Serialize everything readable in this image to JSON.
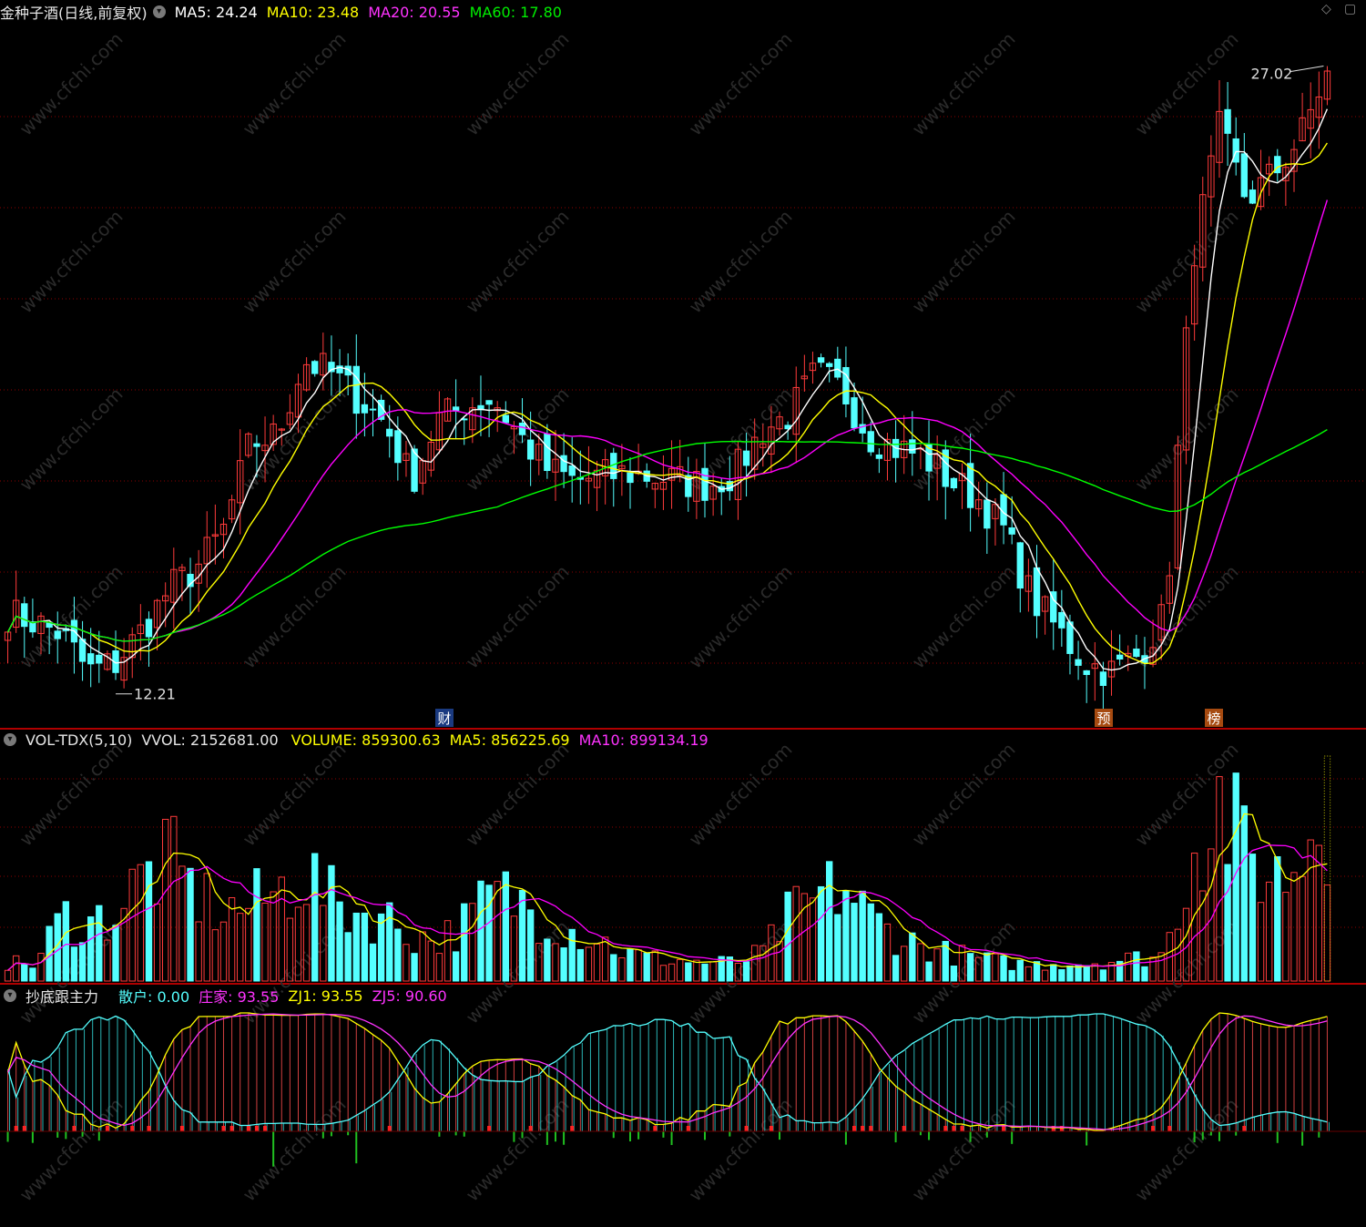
{
  "main_panel": {
    "title": "金种子酒(日线,前复权)",
    "ma5_label": "MA5: 24.24",
    "ma10_label": "MA10: 23.48",
    "ma20_label": "MA20: 20.55",
    "ma60_label": "MA60: 17.80",
    "high_marker": "27.02",
    "low_marker": "12.21",
    "event_markers": [
      "财",
      "预",
      "榜"
    ],
    "corner_icons": [
      "diamond-icon",
      "collapse-icon"
    ]
  },
  "volume_panel": {
    "title": "VOL-TDX(5,10)",
    "vvol_label": "VVOL: 2152681.00",
    "volume_label": "VOLUME: 859300.63",
    "ma5_label": "MA5: 856225.69",
    "ma10_label": "MA10: 899134.19"
  },
  "indicator_panel": {
    "title": "抄底跟主力",
    "retail_label": "散户: 0.00",
    "dealer_label": "庄家: 93.55",
    "zj1_label": "ZJ1: 93.55",
    "zj5_label": "ZJ5: 90.60"
  },
  "colors": {
    "up": "#ff3b3b",
    "down": "#54ffff",
    "ma5": "#ffffff",
    "ma10": "#ffff00",
    "ma20": "#ff00ff",
    "ma60": "#00ff00",
    "panel_line": "#8b0000",
    "watermark": "#2a2a2a"
  },
  "chart_data": [
    {
      "type": "candlestick",
      "title": "金种子酒(日线,前复权)",
      "ylim": [
        11.5,
        28.0
      ],
      "annotations": [
        {
          "text": "27.02",
          "y": 27.02
        },
        {
          "text": "12.21",
          "y": 12.21
        }
      ],
      "events": [
        "财",
        "预",
        "榜"
      ],
      "series": [
        {
          "name": "MA5",
          "value": 24.24
        },
        {
          "name": "MA10",
          "value": 23.48
        },
        {
          "name": "MA20",
          "value": 20.55
        },
        {
          "name": "MA60",
          "value": 17.8
        }
      ],
      "anchors": [
        13.8,
        13.6,
        13.3,
        12.4,
        12.6,
        13.4,
        14.4,
        14.9,
        15.8,
        17.9,
        18.1,
        19.9,
        19.6,
        19.0,
        18.4,
        17.0,
        18.5,
        18.8,
        19.0,
        18.1,
        17.3,
        17.0,
        17.1,
        17.2,
        17.1,
        17.0,
        16.9,
        17.2,
        18.2,
        18.6,
        19.6,
        19.2,
        18.1,
        17.8,
        17.6,
        17.0,
        16.6,
        15.8,
        14.2,
        13.4,
        12.6,
        12.4,
        12.8,
        13.8,
        22.4,
        25.5,
        23.8,
        24.4,
        25.3,
        26.9
      ],
      "vol_anchors": [
        0.08,
        0.07,
        0.28,
        0.25,
        0.3,
        0.45,
        0.52,
        0.38,
        0.3,
        0.33,
        0.38,
        0.48,
        0.35,
        0.3,
        0.28,
        0.2,
        0.18,
        0.25,
        0.38,
        0.35,
        0.28,
        0.22,
        0.18,
        0.12,
        0.1,
        0.09,
        0.08,
        0.08,
        0.12,
        0.28,
        0.35,
        0.42,
        0.28,
        0.2,
        0.15,
        0.12,
        0.1,
        0.08,
        0.07,
        0.08,
        0.08,
        0.09,
        0.1,
        0.12,
        0.6,
        0.78,
        0.55,
        0.45,
        0.52,
        0.95
      ]
    },
    {
      "type": "bar",
      "title": "VOL-TDX(5,10)",
      "series": [
        {
          "name": "VVOL",
          "value": 2152681.0
        },
        {
          "name": "VOLUME",
          "value": 859300.63
        },
        {
          "name": "MA5",
          "value": 856225.69
        },
        {
          "name": "MA10",
          "value": 899134.19
        }
      ]
    },
    {
      "type": "line",
      "title": "抄底跟主力",
      "series": [
        {
          "name": "散户",
          "value": 0.0
        },
        {
          "name": "庄家",
          "value": 93.55
        },
        {
          "name": "ZJ1",
          "value": 93.55
        },
        {
          "name": "ZJ5",
          "value": 90.6
        }
      ]
    }
  ]
}
